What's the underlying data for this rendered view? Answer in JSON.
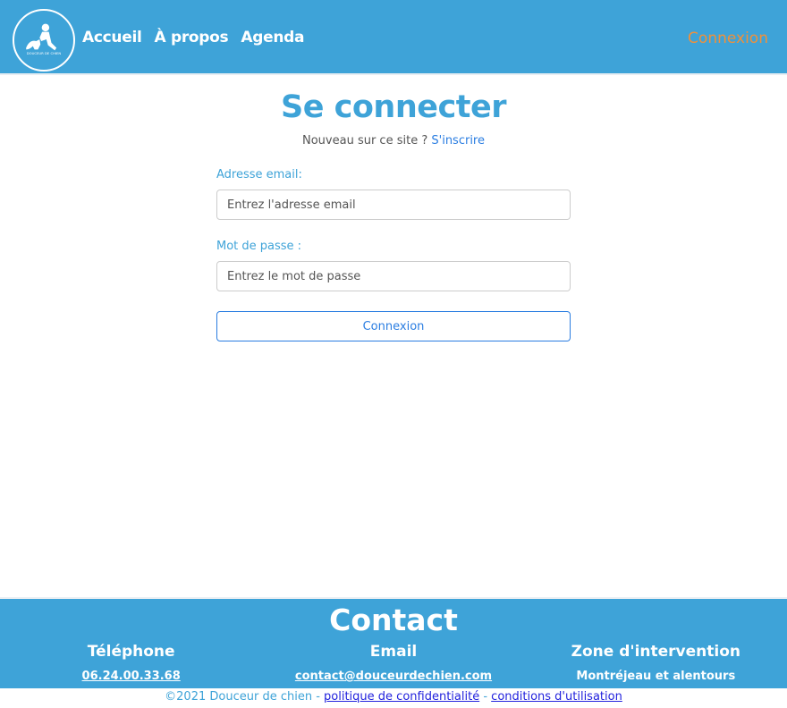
{
  "nav": {
    "logo_text": "DOUCEUR DE CHIEN",
    "links": [
      "Accueil",
      "À propos",
      "Agenda"
    ],
    "login": "Connexion"
  },
  "main": {
    "title": "Se connecter",
    "new_text": "Nouveau sur ce site ?",
    "signup": "S'inscrire",
    "email_label": "Adresse email:",
    "email_placeholder": "Entrez l'adresse email",
    "password_label": "Mot de passe :",
    "password_placeholder": "Entrez le mot de passe",
    "submit": "Connexion"
  },
  "footer": {
    "title": "Contact",
    "columns": [
      {
        "title": "Téléphone",
        "value": "06.24.00.33.68"
      },
      {
        "title": "Email",
        "value": "contact@douceurdechien.com"
      },
      {
        "title": "Zone d'intervention",
        "value": "Montréjeau et alentours"
      }
    ],
    "copyright": "©2021 Douceur de chien -",
    "privacy": "politique de confidentialité",
    "sep": "-",
    "terms": "conditions d'utilisation"
  }
}
